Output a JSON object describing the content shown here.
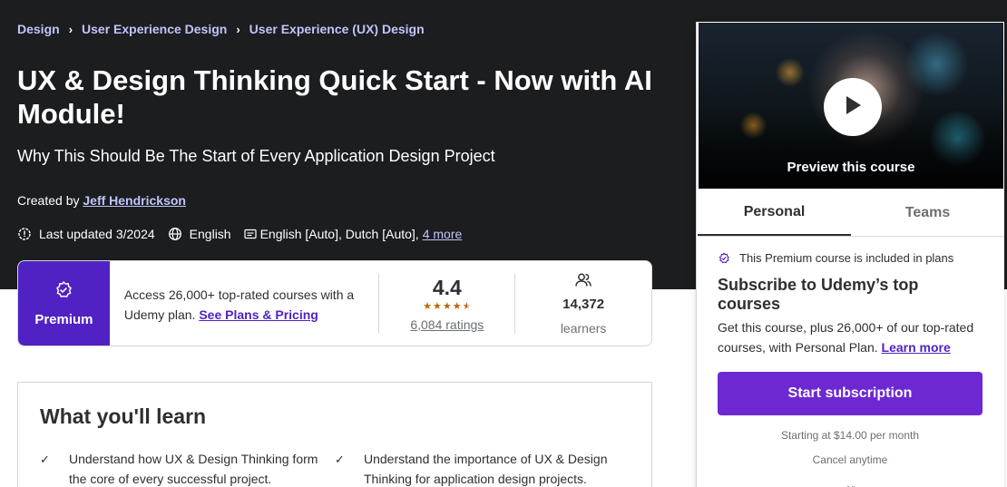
{
  "breadcrumb": [
    "Design",
    "User Experience Design",
    "User Experience (UX) Design"
  ],
  "course": {
    "title": "UX & Design Thinking Quick Start - Now with AI Module!",
    "subtitle": "Why This Should Be The Start of Every Application Design Project",
    "created_by_label": "Created by",
    "instructor": "Jeff Hendrickson",
    "last_updated": "Last updated 3/2024",
    "language": "English",
    "captions": "English [Auto], Dutch [Auto],",
    "more_link": "4 more"
  },
  "stats": {
    "premium_label": "Premium",
    "access_text": "Access 26,000+ top-rated courses with a Udemy plan.",
    "plans_link": "See Plans & Pricing",
    "rating": "4.4",
    "rating_stars": 4.5,
    "ratings_count": "6,084 ratings",
    "learners": "14,372",
    "learners_label": "learners"
  },
  "learn": {
    "heading": "What you'll learn",
    "items": [
      "Understand how UX & Design Thinking form the core of every successful project.",
      "Understand the importance of UX & Design Thinking for application design projects."
    ]
  },
  "sidebar": {
    "preview_label": "Preview this course",
    "tabs": [
      "Personal",
      "Teams"
    ],
    "plan_note": "This Premium course is included in plans",
    "plan_heading": "Subscribe to Udemy’s top courses",
    "plan_desc": "Get this course, plus 26,000+ of our top-rated courses, with Personal Plan.",
    "learn_more": "Learn more",
    "cta": "Start subscription",
    "starting_price": "Starting at $14.00 per month",
    "cancel": "Cancel anytime",
    "or": "or"
  },
  "colors": {
    "hero_bg": "#1c1d1f",
    "premium_bg": "#5022c3",
    "cta_bg": "#6d28d2",
    "link_light": "#c0c4fc",
    "star": "#b4690e"
  }
}
